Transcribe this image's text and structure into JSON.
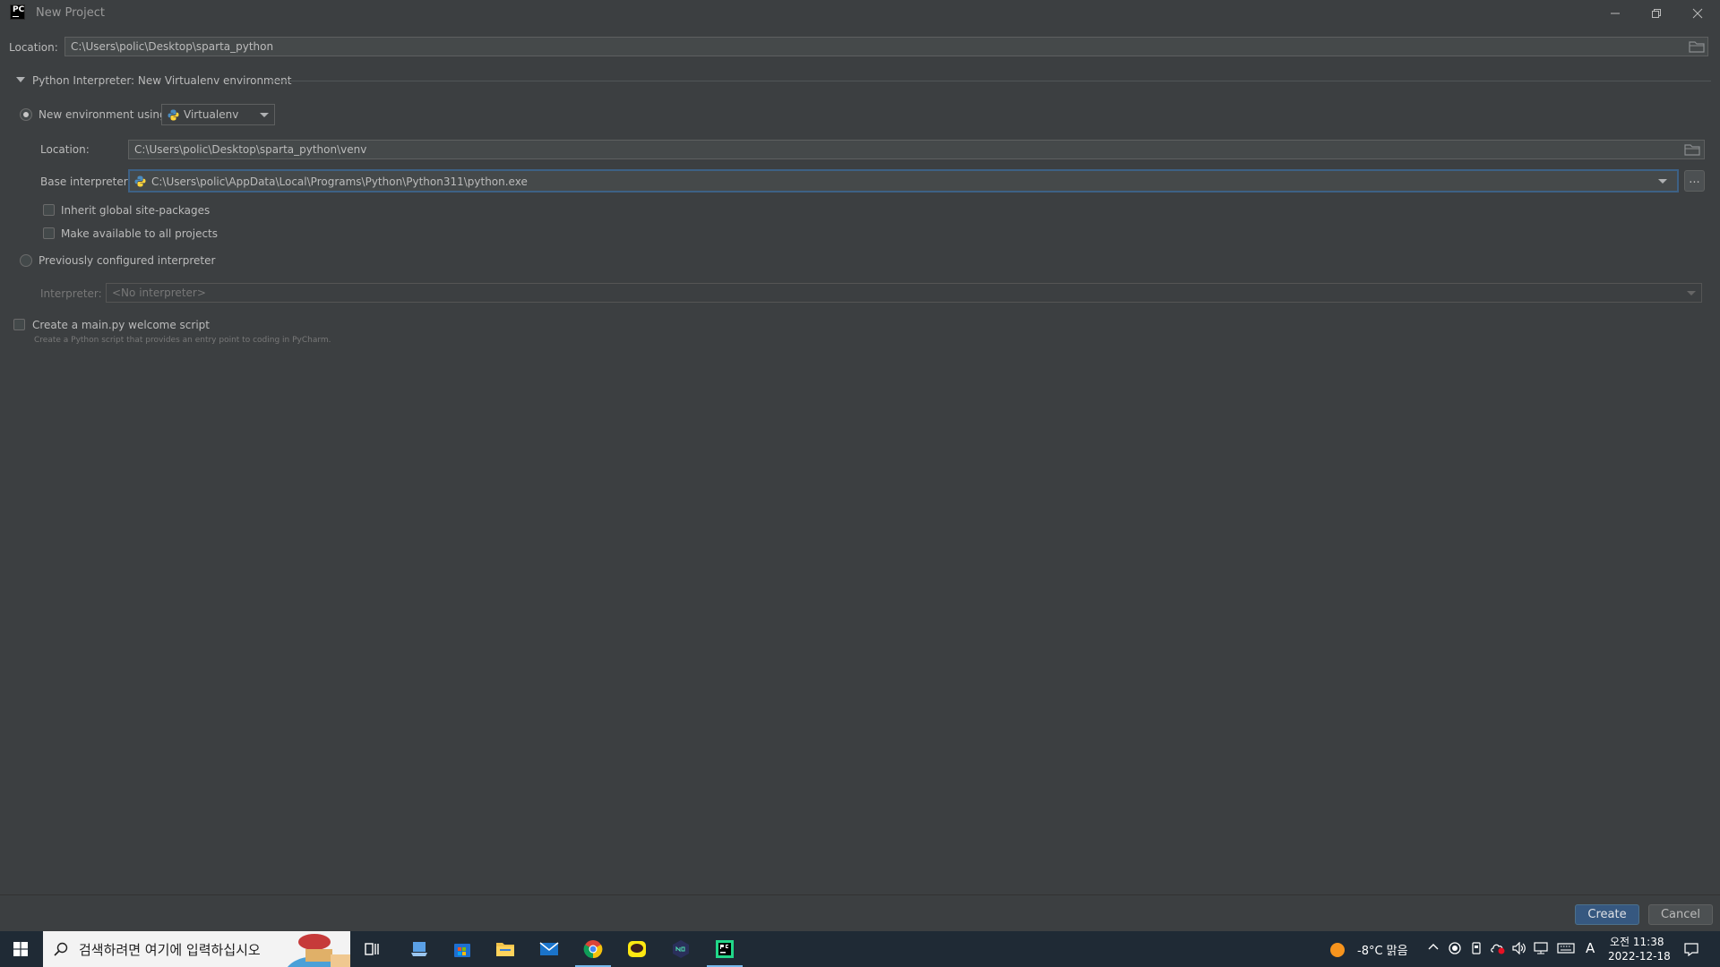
{
  "window": {
    "title": "New Project"
  },
  "project": {
    "location_label": "Location:",
    "location_value": "C:\\Users\\polic\\Desktop\\sparta_python"
  },
  "interpreter_section": {
    "header": "Python Interpreter: New Virtualenv environment",
    "new_env_label": "New environment using",
    "env_tool": "Virtualenv",
    "location_label": "Location:",
    "location_value": "C:\\Users\\polic\\Desktop\\sparta_python\\venv",
    "base_interpreter_label": "Base interpreter:",
    "base_interpreter_value": "C:\\Users\\polic\\AppData\\Local\\Programs\\Python\\Python311\\python.exe",
    "browse_button": "...",
    "inherit_label": "Inherit global site-packages",
    "make_available_label": "Make available to all projects",
    "previous_label": "Previously configured interpreter",
    "interpreter_label": "Interpreter:",
    "interpreter_value": "<No interpreter>"
  },
  "welcome_script": {
    "label": "Create a main.py welcome script",
    "hint": "Create a Python script that provides an entry point to coding in PyCharm."
  },
  "buttons": {
    "create": "Create",
    "cancel": "Cancel"
  },
  "taskbar": {
    "search_placeholder": "검색하려면 여기에 입력하십시오",
    "weather": "-8°C  맑음",
    "time_period": "오전 11:38",
    "date": "2022-12-18",
    "ime": "A"
  },
  "colors": {
    "accent": "#365880",
    "focus_border": "#3d6185",
    "background": "#3c3f41"
  }
}
